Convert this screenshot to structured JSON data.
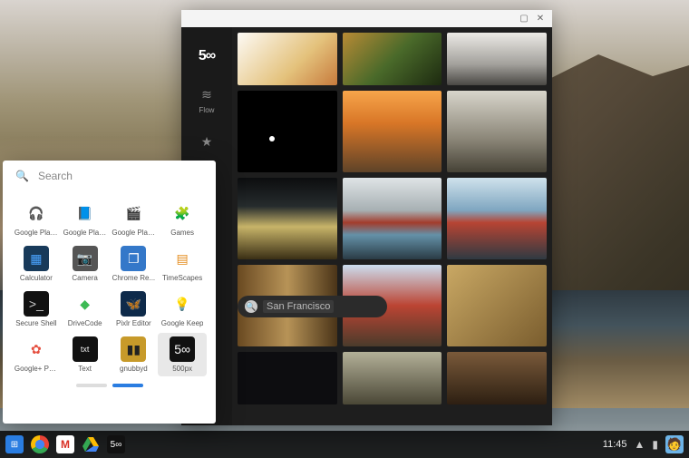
{
  "window": {
    "app_name": "500px",
    "logo_text": "5∞",
    "sidebar": [
      {
        "label": "Flow",
        "icon": "≋"
      },
      {
        "label": "",
        "icon": "★"
      },
      {
        "label": "",
        "icon": "⚙"
      }
    ],
    "search_value": "San Francisco"
  },
  "launcher": {
    "search_placeholder": "Search",
    "items": [
      {
        "label": "Google Play ...",
        "icon_bg": "#fff",
        "icon_fg": "#f59f0b",
        "glyph": "🎧"
      },
      {
        "label": "Google Play ...",
        "icon_bg": "#fff",
        "icon_fg": "#2a6dd6",
        "glyph": "📘"
      },
      {
        "label": "Google Play ...",
        "icon_bg": "#fff",
        "icon_fg": "#c1272d",
        "glyph": "🎬"
      },
      {
        "label": "Games",
        "icon_bg": "#fff",
        "icon_fg": "#22a35d",
        "glyph": "🧩"
      },
      {
        "label": "Calculator",
        "icon_bg": "#183a5a",
        "icon_fg": "#4aa3ff",
        "glyph": "▦"
      },
      {
        "label": "Camera",
        "icon_bg": "#555",
        "icon_fg": "#ddd",
        "glyph": "📷"
      },
      {
        "label": "Chrome Re...",
        "icon_bg": "#3478c9",
        "icon_fg": "#fff",
        "glyph": "❐"
      },
      {
        "label": "TimeScapes",
        "icon_bg": "#fff",
        "icon_fg": "#e38a1a",
        "glyph": "▤"
      },
      {
        "label": "Secure Shell",
        "icon_bg": "#111",
        "icon_fg": "#ccc",
        "glyph": ">_"
      },
      {
        "label": "DriveCode",
        "icon_bg": "#fff",
        "icon_fg": "#3cba54",
        "glyph": "◆"
      },
      {
        "label": "Pixlr Editor",
        "icon_bg": "#0e2a4a",
        "icon_fg": "#6ad7e0",
        "glyph": "🦋"
      },
      {
        "label": "Google Keep",
        "icon_bg": "#fff",
        "icon_fg": "#f4b400",
        "glyph": "💡"
      },
      {
        "label": "Google+ Pho...",
        "icon_bg": "#fff",
        "icon_fg": "#e54e3e",
        "glyph": "✿"
      },
      {
        "label": "Text",
        "icon_bg": "#111",
        "icon_fg": "#eee",
        "glyph": "txt"
      },
      {
        "label": "gnubbyd",
        "icon_bg": "#c79a2a",
        "icon_fg": "#222",
        "glyph": "▮▮"
      },
      {
        "label": "500px",
        "icon_bg": "#111",
        "icon_fg": "#fff",
        "glyph": "5∞",
        "selected": true
      }
    ]
  },
  "shelf": {
    "clock": "11:45",
    "apps": [
      {
        "name": "launcher",
        "bg": "#2a7de1",
        "glyph": "⊞"
      },
      {
        "name": "chrome",
        "bg": "transparent",
        "glyph": "◉"
      },
      {
        "name": "gmail",
        "bg": "#fff",
        "glyph": "M"
      },
      {
        "name": "drive",
        "bg": "transparent",
        "glyph": "◣"
      },
      {
        "name": "500px",
        "bg": "#111",
        "glyph": "5∞"
      }
    ]
  }
}
